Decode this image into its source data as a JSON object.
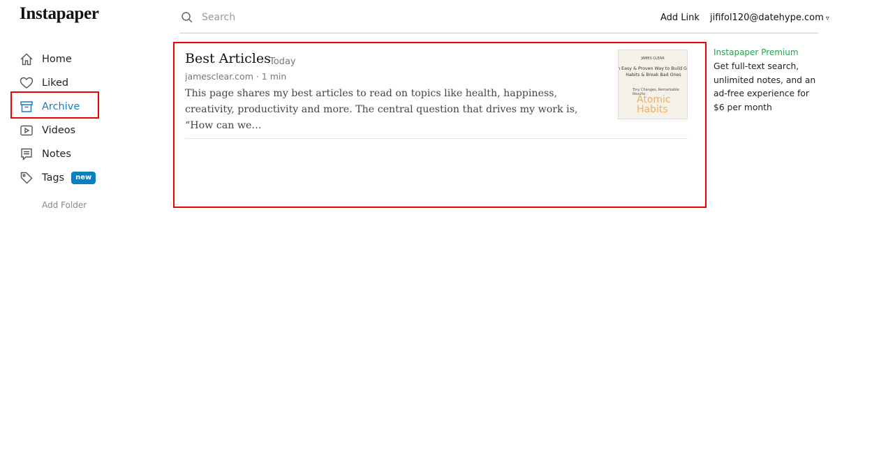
{
  "app": {
    "logo": "Instapaper"
  },
  "sidebar": {
    "items": [
      {
        "label": "Home",
        "icon": "home-icon"
      },
      {
        "label": "Liked",
        "icon": "heart-icon"
      },
      {
        "label": "Archive",
        "icon": "archive-icon",
        "active": true
      },
      {
        "label": "Videos",
        "icon": "video-icon"
      },
      {
        "label": "Notes",
        "icon": "notes-icon"
      },
      {
        "label": "Tags",
        "icon": "tag-icon",
        "badge": "new"
      }
    ],
    "add_folder": "Add Folder"
  },
  "header": {
    "search_placeholder": "Search",
    "add_link": "Add Link",
    "account": "jififol120@datehype.com",
    "account_caret": "▿"
  },
  "articles": [
    {
      "title": "Best Articles",
      "date": "Today",
      "meta": "jamesclear.com · 1 min",
      "excerpt": "This page shares my best articles to read on topics like health, happiness, creativity, productivity and more. The central question that drives my work is, “How can we…",
      "thumbnail": {
        "author": "JAMES CLEAR",
        "subtitle": "n Easy & Proven Way to Build Go Habits & Break Bad Ones",
        "small": "Tiny Changes, Remarkable Results",
        "title": "Atomic Habits"
      }
    }
  ],
  "premium": {
    "title": "Instapaper Premium",
    "body": "Get full-text search, unlimited notes, and an ad-free experience for $6 per month"
  },
  "colors": {
    "accent": "#1a7bbd",
    "premium": "#22a44a",
    "highlight": "#e00000",
    "badge": "#0a7fbf"
  }
}
